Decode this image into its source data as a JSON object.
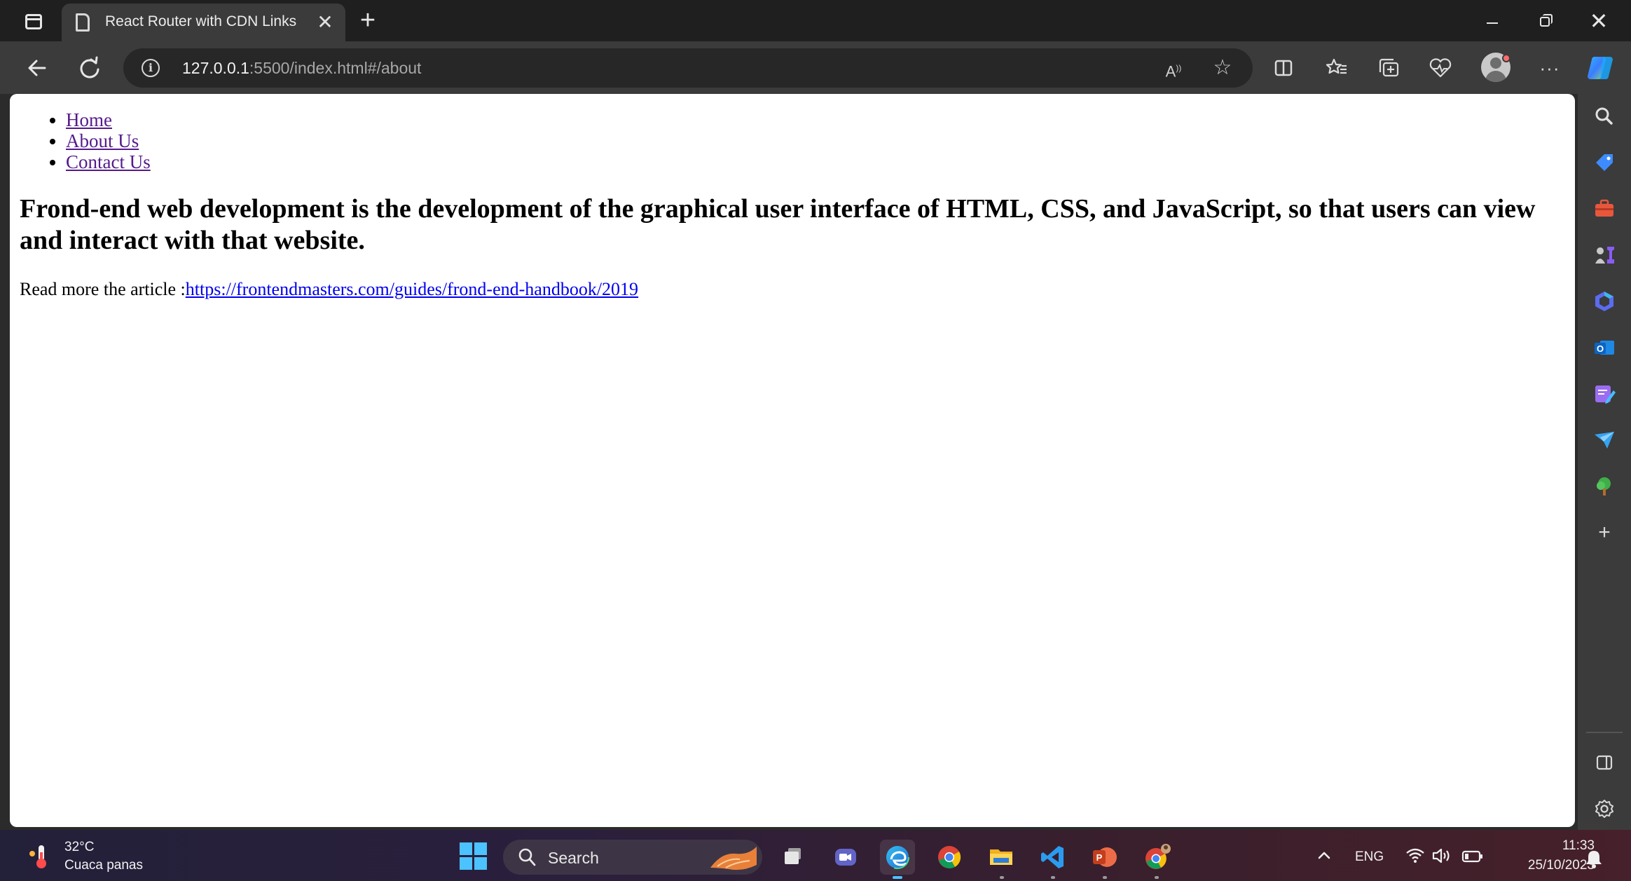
{
  "browser": {
    "tab": {
      "title": "React Router with CDN Links",
      "close": "✕"
    },
    "new_tab": "+",
    "window_controls": {
      "close": "✕"
    },
    "address_bar": {
      "url_host": "127.0.0.1",
      "url_rest": ":5500/index.html#/about"
    },
    "read_aloud_glyph": "A",
    "more_glyph": "···",
    "sidebar_add": "+"
  },
  "page": {
    "nav": [
      "Home",
      "About Us",
      "Contact Us"
    ],
    "heading": "Frond-end web development is the development of the graphical user interface of HTML, CSS, and JavaScript, so that users can view and interact with that website.",
    "read_more_prefix": "Read more the article :",
    "read_more_link": "https://frontendmasters.com/guides/frond-end-handbook/2019"
  },
  "taskbar": {
    "weather": {
      "temp": "32°C",
      "desc": "Cuaca panas"
    },
    "search_label": "Search",
    "apps": [
      "task-view",
      "teams-chat",
      "microsoft-edge",
      "google-chrome",
      "file-explorer",
      "visual-studio-code",
      "powerpoint",
      "chrome-profile"
    ],
    "tray": {
      "lang": "ENG",
      "time": "11:33",
      "date": "25/10/2023"
    }
  },
  "colors": {
    "visited_link": "#551a8b",
    "link": "#0000ee",
    "chrome_dark": "#1f1f1f",
    "chrome_toolbar": "#3b3b3b",
    "accent_blue": "#4cc2ff"
  }
}
